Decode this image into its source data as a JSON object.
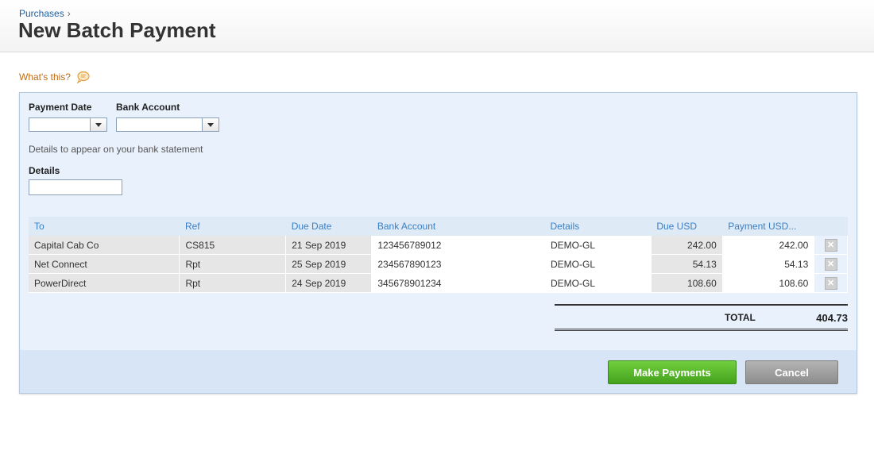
{
  "breadcrumb": {
    "label": "Purchases",
    "separator": "›"
  },
  "page_title": "New Batch Payment",
  "whats_this": "What's this?",
  "form": {
    "payment_date_label": "Payment Date",
    "payment_date_value": "",
    "bank_account_label": "Bank Account",
    "bank_account_value": "",
    "hint": "Details to appear on your bank statement",
    "details_label": "Details",
    "details_value": ""
  },
  "table": {
    "columns": [
      "To",
      "Ref",
      "Due Date",
      "Bank Account",
      "Details",
      "Due USD",
      "Payment USD..."
    ],
    "rows": [
      {
        "to": "Capital Cab Co",
        "ref": "CS815",
        "due_date": "21 Sep 2019",
        "bank_account": "123456789012",
        "details": "DEMO-GL",
        "due": "242.00",
        "payment": "242.00"
      },
      {
        "to": "Net Connect",
        "ref": "Rpt",
        "due_date": "25 Sep 2019",
        "bank_account": "234567890123",
        "details": "DEMO-GL",
        "due": "54.13",
        "payment": "54.13"
      },
      {
        "to": "PowerDirect",
        "ref": "Rpt",
        "due_date": "24 Sep 2019",
        "bank_account": "345678901234",
        "details": "DEMO-GL",
        "due": "108.60",
        "payment": "108.60"
      }
    ],
    "remove_icon": "close-icon"
  },
  "total": {
    "label": "TOTAL",
    "value": "404.73"
  },
  "buttons": {
    "make_payments": "Make Payments",
    "cancel": "Cancel"
  },
  "colors": {
    "link": "#1a5fa6",
    "whats_this": "#c26a10",
    "primary_button": "#4caf20",
    "panel_bg": "#e8f1fc"
  }
}
